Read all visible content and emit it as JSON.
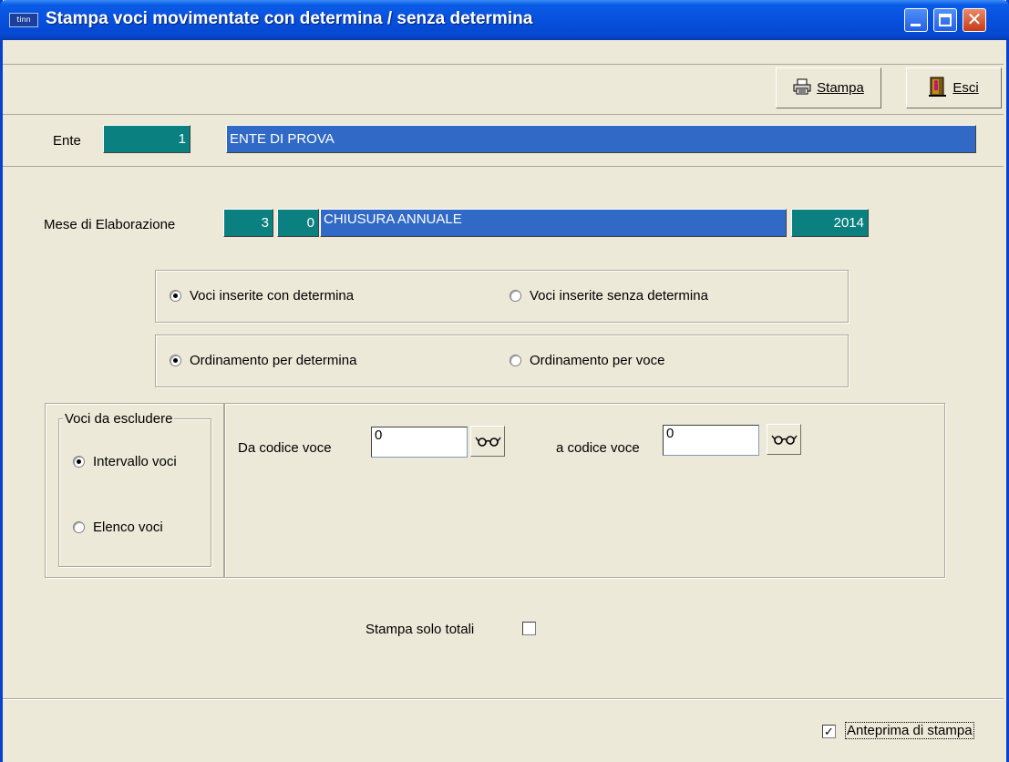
{
  "window": {
    "app_icon_text": "tinn",
    "title": "Stampa voci movimentate con determina / senza determina",
    "controls": {
      "minimize": "minimize-icon",
      "maximize": "maximize-icon",
      "close": "close-icon"
    },
    "accent_color": "#0750de"
  },
  "toolbar": {
    "print_label": "Stampa",
    "exit_label": "Esci",
    "print_icon": "printer-icon",
    "exit_icon": "exit-door-icon"
  },
  "ente": {
    "label": "Ente",
    "code": "1",
    "name": "ENTE DI PROVA"
  },
  "elaborazione": {
    "label": "Mese di Elaborazione",
    "month": "3",
    "sub": "0",
    "description": "CHIUSURA ANNUALE",
    "year": "2014"
  },
  "tipo_voci": {
    "options": [
      "Voci inserite con determina",
      "Voci inserite senza determina"
    ],
    "selected": 0
  },
  "ordinamento": {
    "options": [
      "Ordinamento per determina",
      "Ordinamento per voce"
    ],
    "selected": 0
  },
  "voci_da_escludere": {
    "legend": "Voci da escludere",
    "options": [
      "Intervallo voci",
      "Elenco voci"
    ],
    "selected": 0
  },
  "intervallo": {
    "from_label": "Da codice voce",
    "from_value": "0",
    "to_label": "a codice voce",
    "to_value": "0",
    "lookup_icon": "glasses-lookup-icon"
  },
  "solo_totali": {
    "label": "Stampa solo totali",
    "checked": false
  },
  "anteprima": {
    "label": "Anteprima di stampa",
    "checked": true
  },
  "colors": {
    "teal_field": "#0b8080",
    "blue_field": "#3169c6",
    "face": "#ece9d8"
  }
}
